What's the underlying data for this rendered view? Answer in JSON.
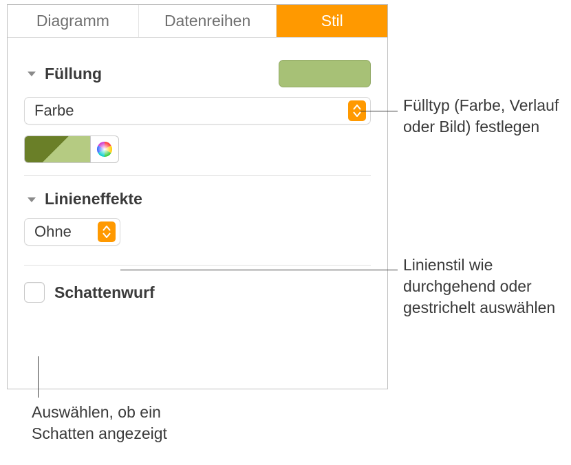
{
  "tabs": {
    "diagram": "Diagramm",
    "series": "Datenreihen",
    "style": "Stil"
  },
  "fill": {
    "title": "Füllung",
    "type_label": "Farbe",
    "swatch_color": "#a7c176"
  },
  "line": {
    "title": "Linieneffekte",
    "style_label": "Ohne"
  },
  "shadow": {
    "label": "Schattenwurf"
  },
  "callouts": {
    "fill_type": "Fülltyp (Farbe, Verlauf oder Bild) festlegen",
    "line_style": "Linienstil wie durchgehend oder gestrichelt auswählen",
    "shadow_check": "Auswählen, ob ein Schatten angezeigt"
  }
}
